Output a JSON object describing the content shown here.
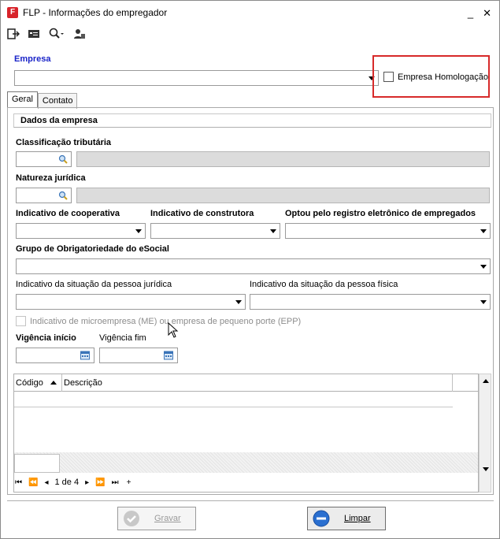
{
  "window": {
    "title": "FLP - Informações do empregador",
    "minimize": "_",
    "close": "✕"
  },
  "toolbar": {
    "icons": [
      "exit-icon",
      "card-icon",
      "search-icon",
      "user-icon"
    ]
  },
  "empresa": {
    "label": "Empresa",
    "value": ""
  },
  "homologacao": {
    "label": "Empresa Homologação",
    "checked": false
  },
  "tabs": [
    {
      "label": "Geral"
    },
    {
      "label": "Contato"
    }
  ],
  "section": {
    "title": "Dados da empresa"
  },
  "fields": {
    "classificacao": {
      "label": "Classificação tributária"
    },
    "natureza": {
      "label": "Natureza jurídica"
    },
    "cooperativa": {
      "label": "Indicativo de cooperativa"
    },
    "construtora": {
      "label": "Indicativo de construtora"
    },
    "registro": {
      "label": "Optou pelo registro eletrônico de empregados"
    },
    "grupo": {
      "label": "Grupo de Obrigatoriedade do eSocial"
    },
    "sit_juridica": {
      "label": "Indicativo da situação da pessoa jurídica"
    },
    "sit_fisica": {
      "label": "Indicativo da situação da pessoa física"
    },
    "microempresa": {
      "label": "Indicativo de microempresa (ME) ou empresa de pequeno porte (EPP)"
    },
    "vig_inicio": {
      "label": "Vigência início"
    },
    "vig_fim": {
      "label": "Vigência fim"
    }
  },
  "grid": {
    "columns": [
      "Código",
      "Descrição"
    ]
  },
  "pager": {
    "first": "⏮",
    "prev_page": "⏪",
    "prev": "◂",
    "page_text": "1 de 4",
    "next": "▸",
    "next_page": "⏩",
    "last": "⏭"
  },
  "buttons": {
    "gravar": "Gravar",
    "limpar": "Limpar"
  },
  "colors": {
    "accent": "#1a24c8",
    "highlight_border": "#d72a2a"
  }
}
